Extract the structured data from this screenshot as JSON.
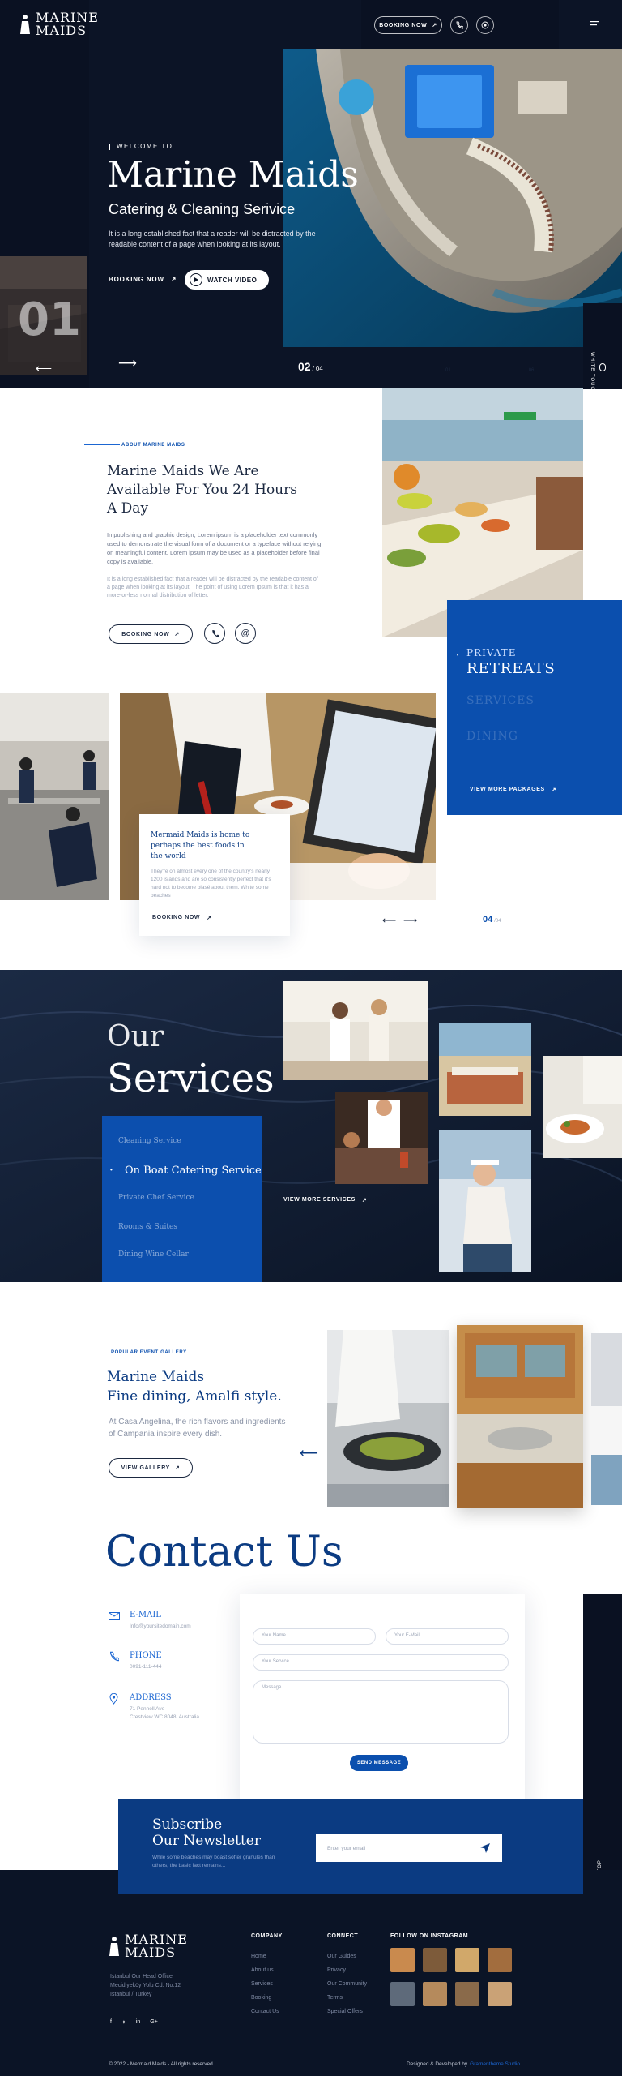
{
  "header": {
    "logo_line1": "MARINE",
    "logo_line2": "MAIDS",
    "booking_label": "BOOKING NOW"
  },
  "hero": {
    "eyebrow": "WELCOME TO",
    "title": "Marine Maids",
    "subtitle": "Catering & Cleaning Serivice",
    "description": "It is a long established fact that a reader will be distracted by the readable content of a page when looking at its layout.",
    "booking_label": "BOOKING NOW",
    "watch_label": "WATCH VIDEO",
    "big_number": "01",
    "slide_current": "02",
    "slide_total": "04",
    "side_tab": "WHITE TOUCH",
    "progress_start": "01",
    "progress_end": "06"
  },
  "about": {
    "tag": "ABOUT MARINE MAIDS",
    "title": "Marine Maids We Are Available For You 24 Hours A Day",
    "para1": "In publishing and graphic design, Lorem ipsum is a placeholder text commonly used to demonstrate the visual form of a document or a typeface without relying on meaningful content. Lorem ipsum may be used as a placeholder before final copy is available.",
    "para2": "It is a long established fact that a reader will be distracted by the readable content of a page when looking at its layout. The point of using Lorem Ipsum is that it has a more-or-less normal distribution of letter.",
    "booking_label": "BOOKING NOW"
  },
  "packages": {
    "items": [
      {
        "label": "PRIVATE"
      },
      {
        "label": "RETREATS"
      },
      {
        "label": "SERVICES"
      },
      {
        "label": "DINING"
      }
    ],
    "view_more": "VIEW MORE PACKAGES"
  },
  "feature_card": {
    "title": "Mermaid Maids is home to perhaps the best foods in the world",
    "text": "They're on almost every one of the country's nearly 1200 islands and are so consistently perfect that it's hard not to become blasé about them. White some beaches",
    "booking_label": "BOOKING NOW",
    "slide_current": "04",
    "slide_total": "/04"
  },
  "services": {
    "title_line1": "Our",
    "title_line2": "Services",
    "items": [
      {
        "label": "Cleaning Service"
      },
      {
        "label": "On Boat Catering Service"
      },
      {
        "label": "Private Chef Service"
      },
      {
        "label": "Rooms & Suites"
      },
      {
        "label": "Dining Wine Cellar"
      }
    ],
    "view_more": "VIEW MORE SERVICES"
  },
  "gallery": {
    "tag": "POPULAR EVENT GALLERY",
    "title_line1": "Marine Maids",
    "title_line2": "Fine dining, Amalfi style.",
    "text": "At Casa Angelina, the rich flavors and ingredients of Campania inspire every dish.",
    "button": "VIEW GALLERY"
  },
  "contact": {
    "title": "Contact Us",
    "email_label": "E-MAIL",
    "email_value": "Info@yoursitedomain.com",
    "phone_label": "PHONE",
    "phone_value": "0091-111-444",
    "address_label": "ADDRESS",
    "address_line1": "71 Pennell Ave",
    "address_line2": "Crestview WC 8048, Australia",
    "form": {
      "name_placeholder": "Your Name",
      "email_placeholder": "Your E-Mail",
      "service_placeholder": "Your Service",
      "message_placeholder": "Message",
      "send_label": "SEND MESSAGE"
    },
    "back_to_top": "BACK TO TOP"
  },
  "newsletter": {
    "title_line1": "Subscribe",
    "title_line2": "Our Newsletter",
    "text": "While some beaches may boast softer granules than others, the basic fact remains...",
    "placeholder": "Enter your email"
  },
  "footer": {
    "address_lines": [
      "Istanbul Our Head Office",
      "Mecidiyeköy Yolu Cd. No:12",
      "Istanbul / Turkey"
    ],
    "company_title": "COMPANY",
    "company_links": [
      "Home",
      "About us",
      "Services",
      "Booking",
      "Contact Us"
    ],
    "connect_title": "CONNECT",
    "connect_links": [
      "Our Guides",
      "Privacy",
      "Our Community",
      "Terms",
      "Special Offers"
    ],
    "instagram_title": "FOLLOW ON INSTAGRAM",
    "copyright": "© 2022 - Mermaid Maids - All rights reserved.",
    "credit_prefix": "Designed & Developed by",
    "credit_name": "Gramentheme Studio"
  },
  "colors": {
    "navy": "#0c1426",
    "blue": "#0b4fae",
    "accent": "#1b66d2"
  }
}
